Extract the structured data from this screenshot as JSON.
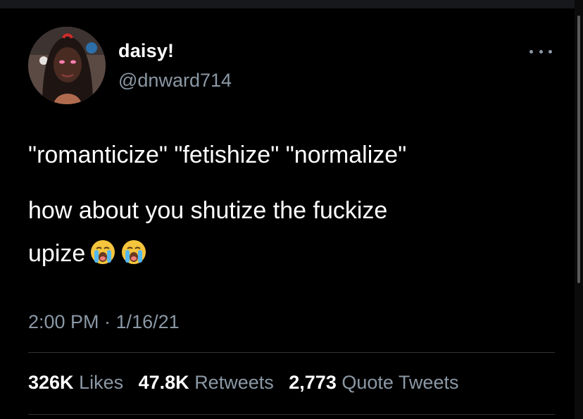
{
  "tweet": {
    "author": {
      "display_name": "daisy!",
      "handle": "@dnward714",
      "avatar_icon": "profile-photo"
    },
    "more_icon": "ellipsis-icon",
    "text_lines": [
      "\"romanticize\" \"fetishize\" \"normalize\"",
      "how about you shutize the fuckize",
      "upize"
    ],
    "emoji": [
      "loudly-crying-face",
      "loudly-crying-face"
    ],
    "timestamp": "2:00 PM · 1/16/21",
    "stats": {
      "likes_value": "326K",
      "likes_label": "Likes",
      "retweets_value": "47.8K",
      "retweets_label": "Retweets",
      "quotes_value": "2,773",
      "quotes_label": "Quote Tweets"
    }
  },
  "colors": {
    "background": "#000000",
    "primary_text": "#ffffff",
    "secondary_text": "#8b98a5",
    "divider": "#2f3336"
  }
}
